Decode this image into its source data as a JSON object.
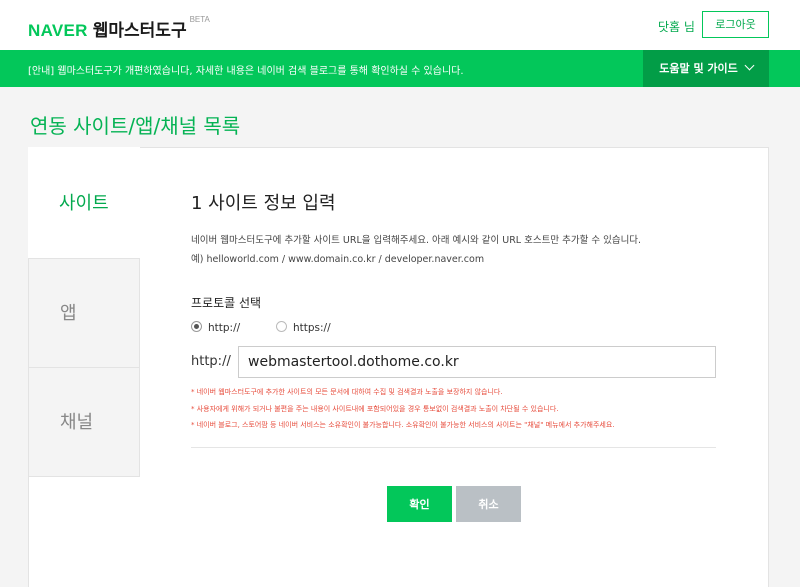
{
  "header": {
    "brand": "NAVER",
    "service": "웹마스터도구",
    "beta": "BETA",
    "user": "닷홈 님",
    "logout": "로그아웃"
  },
  "notice": {
    "text": "[안내] 웹마스터도구가 개편하였습니다, 자세한 내용은 네이버 검색 블로그를 통해 확인하실 수 있습니다.",
    "help": "도움말 및 가이드"
  },
  "page": {
    "title": "연동 사이트/앱/채널 목록"
  },
  "tabs": [
    {
      "label": "사이트",
      "active": true
    },
    {
      "label": "앱",
      "active": false
    },
    {
      "label": "채널",
      "active": false
    }
  ],
  "form": {
    "step_title": "1 사이트 정보 입력",
    "description": "네이버 웹마스터도구에 추가할 사이트 URL을 입력해주세요. 아래 예시와 같이 URL 호스트만 추가할 수 있습니다.",
    "example": "예) helloworld.com / www.domain.co.kr / developer.naver.com",
    "protocol_label": "프로토콜 선택",
    "protocol_options": [
      "http://",
      "https://"
    ],
    "protocol_selected": "http://",
    "url_prefix": "http://",
    "url_value": "webmastertool.dothome.co.kr",
    "notes": [
      "* 네이버 웹마스터도구에 추가한 사이트의 모든 문서에 대하여 수집 및 검색결과 노출을 보장하지 않습니다.",
      "* 사용자에게 위해가 되거나 불편을 주는 내용이 사이트내에 포함되어있을 경우 통보없이 검색결과 노출이 차단될 수 있습니다.",
      "* 네이버 블로그, 스토어팜 등 네이버 서비스는 소유확인이 불가능합니다. 소유확인이 불가능한 서비스의 사이트는 \"채널\" 메뉴에서 추가해주세요."
    ],
    "confirm": "확인",
    "cancel": "취소"
  },
  "colors": {
    "brand_green": "#03c75a",
    "dark_green": "#029d47",
    "note_red": "#e74c3c",
    "cancel_gray": "#bac0c5"
  },
  "icons": {
    "help_toggle": "chevron-down-icon"
  }
}
